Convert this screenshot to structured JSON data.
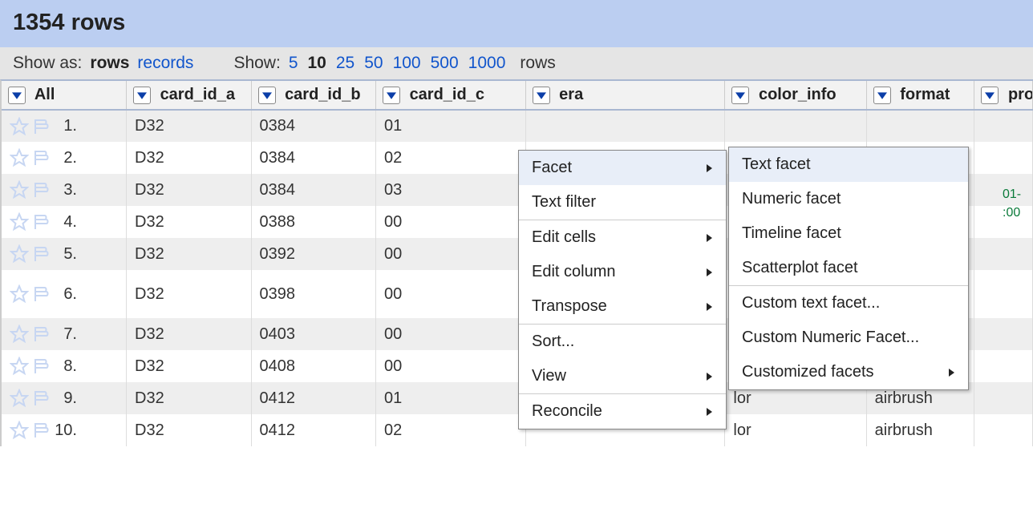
{
  "header": {
    "title": "1354 rows"
  },
  "controls": {
    "show_as_label": "Show as:",
    "show_as_rows": "rows",
    "show_as_records": "records",
    "show_label": "Show:",
    "page_sizes": [
      "5",
      "10",
      "25",
      "50",
      "100",
      "500",
      "1000"
    ],
    "active_page_size": "10",
    "rows_suffix": "rows"
  },
  "columns": {
    "all": "All",
    "card_id_a": "card_id_a",
    "card_id_b": "card_id_b",
    "card_id_c": "card_id_c",
    "era": "era",
    "color_info": "color_info",
    "format": "format",
    "prod": "prod"
  },
  "rows": [
    {
      "n": "1.",
      "a": "D32",
      "b": "0384",
      "c": "01",
      "era": "",
      "color": "",
      "format": ""
    },
    {
      "n": "2.",
      "a": "D32",
      "b": "0384",
      "c": "02",
      "era": "",
      "color": "",
      "format": ""
    },
    {
      "n": "3.",
      "a": "D32",
      "b": "0384",
      "c": "03",
      "era": "",
      "color": "",
      "format": ""
    },
    {
      "n": "4.",
      "a": "D32",
      "b": "0388",
      "c": "00",
      "era": "",
      "color": "",
      "format": ""
    },
    {
      "n": "5.",
      "a": "D32",
      "b": "0392",
      "c": "00",
      "era": "",
      "color": "",
      "format": ""
    },
    {
      "n": "6.",
      "a": "D32",
      "b": "0398",
      "c": "00",
      "era": "",
      "color": "",
      "format": ""
    },
    {
      "n": "7.",
      "a": "D32",
      "b": "0403",
      "c": "00",
      "era": "",
      "color": "",
      "format": ""
    },
    {
      "n": "8.",
      "a": "D32",
      "b": "0408",
      "c": "00",
      "era": "",
      "color": "",
      "format": ""
    },
    {
      "n": "9.",
      "a": "D32",
      "b": "0412",
      "c": "01",
      "era": "",
      "color": "lor",
      "format": "airbrush"
    },
    {
      "n": "10.",
      "a": "D32",
      "b": "0412",
      "c": "02",
      "era": "",
      "color": "lor",
      "format": "airbrush"
    }
  ],
  "menu": {
    "facet": "Facet",
    "text_filter": "Text filter",
    "edit_cells": "Edit cells",
    "edit_column": "Edit column",
    "transpose": "Transpose",
    "sort": "Sort...",
    "view": "View",
    "reconcile": "Reconcile"
  },
  "submenu": {
    "text_facet": "Text facet",
    "numeric_facet": "Numeric facet",
    "timeline_facet": "Timeline facet",
    "scatterplot_facet": "Scatterplot facet",
    "custom_text_facet": "Custom text facet...",
    "custom_numeric_facet": "Custom Numeric Facet...",
    "customized_facets": "Customized facets"
  },
  "partial": {
    "line1": "01-",
    "line2": ":00"
  }
}
